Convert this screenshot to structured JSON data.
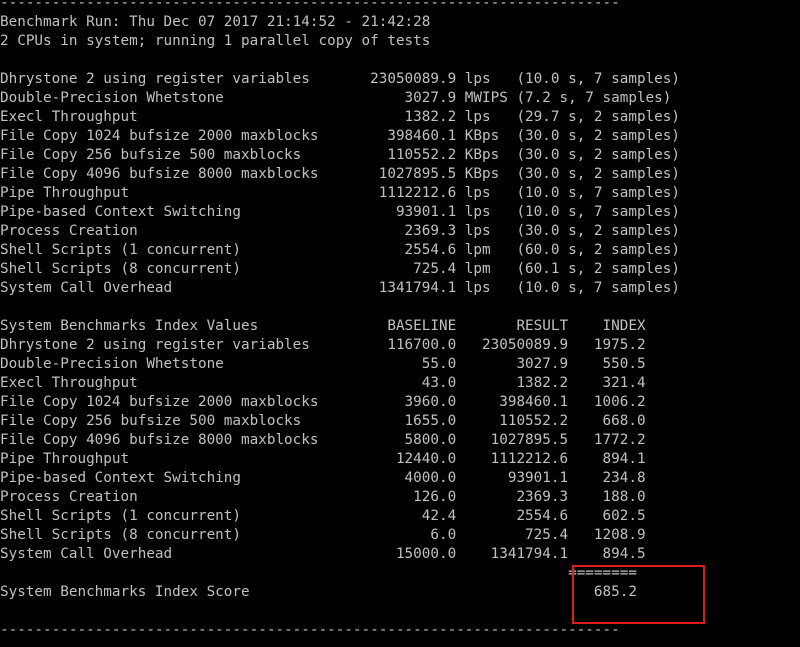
{
  "terminal": {
    "separator": "------------------------------------------------------------------------",
    "run_header": "Benchmark Run: Thu Dec 07 2017 21:14:52 - 21:42:28",
    "cpu_info": "2 CPUs in system; running 1 parallel copy of tests",
    "raw_results": [
      "Dhrystone 2 using register variables       23050089.9 lps   (10.0 s, 7 samples)",
      "Double-Precision Whetstone                     3027.9 MWIPS (7.2 s, 7 samples)",
      "Execl Throughput                               1382.2 lps   (29.7 s, 2 samples)",
      "File Copy 1024 bufsize 2000 maxblocks        398460.1 KBps  (30.0 s, 2 samples)",
      "File Copy 256 bufsize 500 maxblocks          110552.2 KBps  (30.0 s, 2 samples)",
      "File Copy 4096 bufsize 8000 maxblocks       1027895.5 KBps  (30.0 s, 2 samples)",
      "Pipe Throughput                             1112212.6 lps   (10.0 s, 7 samples)",
      "Pipe-based Context Switching                  93901.1 lps   (10.0 s, 7 samples)",
      "Process Creation                               2369.3 lps   (30.0 s, 2 samples)",
      "Shell Scripts (1 concurrent)                   2554.6 lpm   (60.0 s, 2 samples)",
      "Shell Scripts (8 concurrent)                    725.4 lpm   (60.1 s, 2 samples)",
      "System Call Overhead                        1341794.1 lps   (10.0 s, 7 samples)"
    ],
    "index_header": "System Benchmarks Index Values               BASELINE       RESULT    INDEX",
    "index_rows": [
      "Dhrystone 2 using register variables         116700.0   23050089.9   1975.2",
      "Double-Precision Whetstone                       55.0       3027.9    550.5",
      "Execl Throughput                                 43.0       1382.2    321.4",
      "File Copy 1024 bufsize 2000 maxblocks          3960.0     398460.1   1006.2",
      "File Copy 256 bufsize 500 maxblocks            1655.0     110552.2    668.0",
      "File Copy 4096 bufsize 8000 maxblocks          5800.0    1027895.5   1772.2",
      "Pipe Throughput                               12440.0    1112212.6    894.1",
      "Pipe-based Context Switching                   4000.0      93901.1    234.8",
      "Process Creation                                126.0       2369.3    188.0",
      "Shell Scripts (1 concurrent)                     42.4       2554.6    602.5",
      "Shell Scripts (8 concurrent)                      6.0        725.4   1208.9",
      "System Call Overhead                          15000.0    1341794.1    894.5"
    ],
    "score_rule": "                                                                  ========",
    "score_line": "System Benchmarks Index Score                                        685.2"
  },
  "colors": {
    "background": "#000000",
    "text": "#c0c0c0",
    "highlight": "#e01b1b"
  }
}
